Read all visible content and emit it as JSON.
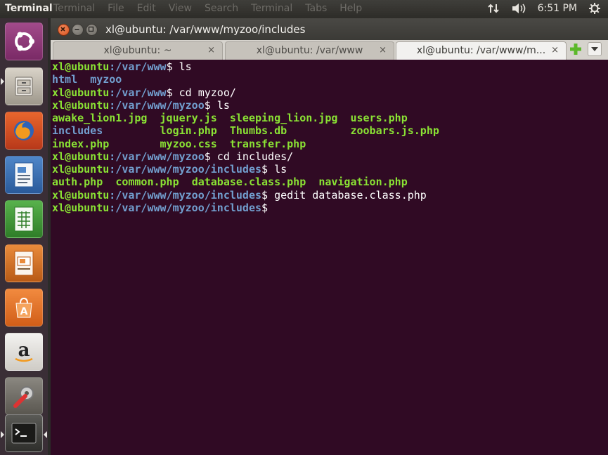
{
  "panel": {
    "app_title": "Terminal",
    "menu": [
      "Terminal",
      "File",
      "Edit",
      "View",
      "Search",
      "Terminal",
      "Tabs",
      "Help"
    ],
    "time": "6:51 PM",
    "icons": [
      "network-arrows-icon",
      "volume-icon",
      "gear-icon"
    ]
  },
  "launcher": {
    "items": [
      "ubuntu-dash",
      "files",
      "firefox",
      "libreoffice-writer",
      "libreoffice-calc",
      "libreoffice-impress",
      "software-center",
      "amazon",
      "system-settings",
      "terminal"
    ]
  },
  "window": {
    "title": "xl@ubuntu: /var/www/myzoo/includes",
    "tabs": [
      {
        "label": "xl@ubuntu: ~",
        "close": "×"
      },
      {
        "label": "xl@ubuntu: /var/www",
        "close": "×"
      },
      {
        "label": "xl@ubuntu: /var/www/m...",
        "close": "×"
      }
    ]
  },
  "terminal": {
    "user": "xl@ubuntu",
    "lines": [
      {
        "path": ":/var/www",
        "cmd": "$ ls"
      },
      {
        "out": [
          [
            "d",
            "html"
          ],
          [
            "t",
            "  "
          ],
          [
            "d",
            "myzoo"
          ]
        ]
      },
      {
        "path": ":/var/www",
        "cmd": "$ cd myzoo/"
      },
      {
        "path": ":/var/www/myzoo",
        "cmd": "$ ls"
      },
      {
        "out": [
          [
            "f",
            "awake_lion1.jpg"
          ],
          [
            "t",
            "  "
          ],
          [
            "f",
            "jquery.js"
          ],
          [
            "t",
            "  "
          ],
          [
            "f",
            "sleeping_lion.jpg"
          ],
          [
            "t",
            "  "
          ],
          [
            "f",
            "users.php"
          ]
        ]
      },
      {
        "out": [
          [
            "d",
            "includes"
          ],
          [
            "t",
            "         "
          ],
          [
            "f",
            "login.php"
          ],
          [
            "t",
            "  "
          ],
          [
            "f",
            "Thumbs.db"
          ],
          [
            "t",
            "          "
          ],
          [
            "f",
            "zoobars.js.php"
          ]
        ]
      },
      {
        "out": [
          [
            "f",
            "index.php"
          ],
          [
            "t",
            "        "
          ],
          [
            "f",
            "myzoo.css"
          ],
          [
            "t",
            "  "
          ],
          [
            "f",
            "transfer.php"
          ]
        ]
      },
      {
        "path": ":/var/www/myzoo",
        "cmd": "$ cd includes/"
      },
      {
        "path": ":/var/www/myzoo/includes",
        "cmd": "$ ls"
      },
      {
        "out": [
          [
            "f",
            "auth.php"
          ],
          [
            "t",
            "  "
          ],
          [
            "f",
            "common.php"
          ],
          [
            "t",
            "  "
          ],
          [
            "f",
            "database.class.php"
          ],
          [
            "t",
            "  "
          ],
          [
            "f",
            "navigation.php"
          ]
        ]
      },
      {
        "path": ":/var/www/myzoo/includes",
        "cmd": "$ gedit database.class.php"
      },
      {
        "path": ":/var/www/myzoo/includes",
        "cmd": "$"
      }
    ]
  },
  "colors": {
    "terminal_bg": "#300a24",
    "user_green": "#8ae234",
    "path_blue": "#729fcf",
    "close_orange": "#e05c2b"
  }
}
